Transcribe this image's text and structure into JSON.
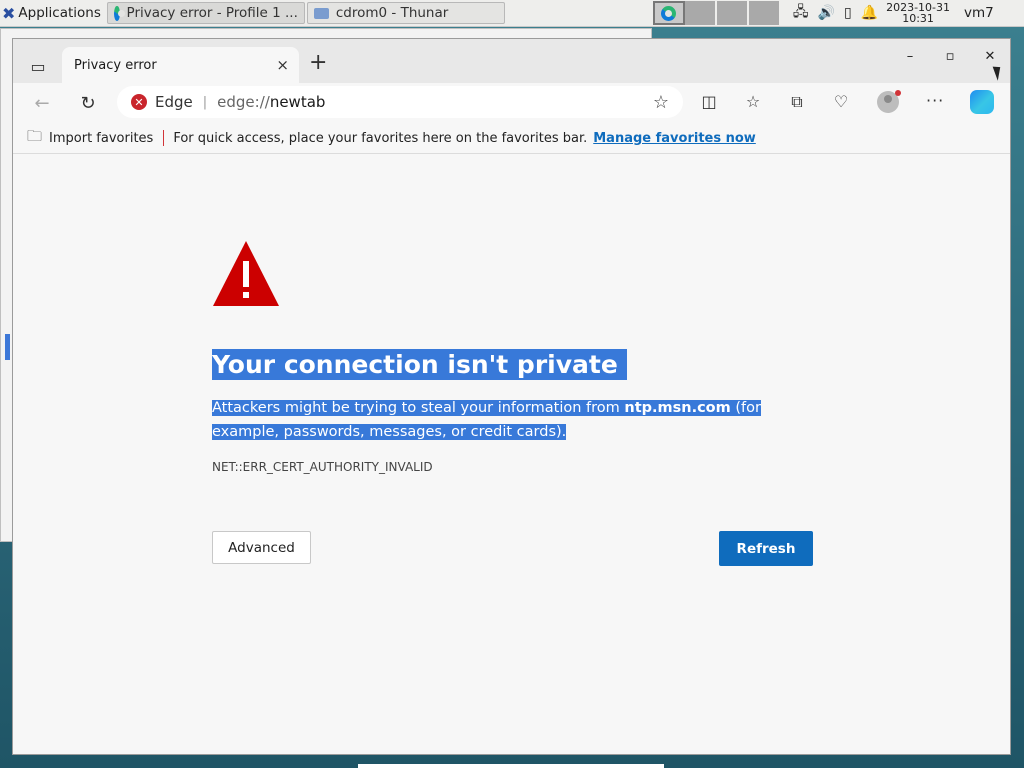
{
  "taskbar": {
    "applications_label": "Applications",
    "windows": [
      {
        "label": "Privacy error - Profile 1 ...",
        "icon": "edge-icon"
      },
      {
        "label": "cdrom0 - Thunar",
        "icon": "folder-icon"
      }
    ],
    "clock": {
      "date": "2023-10-31",
      "time": "10:31"
    },
    "user": "vm7"
  },
  "browser": {
    "tab_title": "Privacy error",
    "tab_close": "×",
    "new_tab": "+",
    "controls": {
      "minimize": "–",
      "maximize": "▫",
      "close": "✕"
    },
    "address": {
      "site_label": "Edge",
      "url_scheme": "edge://",
      "url_host": "newtab"
    },
    "favorites_bar": {
      "import_label": "Import favorites",
      "hint": "For quick access, place your favorites here on the favorites bar.",
      "manage_link": "Manage favorites now"
    }
  },
  "page": {
    "headline": "Your connection isn't private",
    "desc_before": "Attackers might be trying to steal your information from ",
    "desc_host": "ntp.msn.com",
    "desc_after": " (for example, passwords, messages, or credit cards).",
    "error_code": "NET::ERR_CERT_AUTHORITY_INVALID",
    "advanced_button": "Advanced",
    "refresh_button": "Refresh"
  },
  "colors": {
    "accent": "#0f6cbd",
    "selection": "#3879d9",
    "warning": "#cc0000"
  }
}
